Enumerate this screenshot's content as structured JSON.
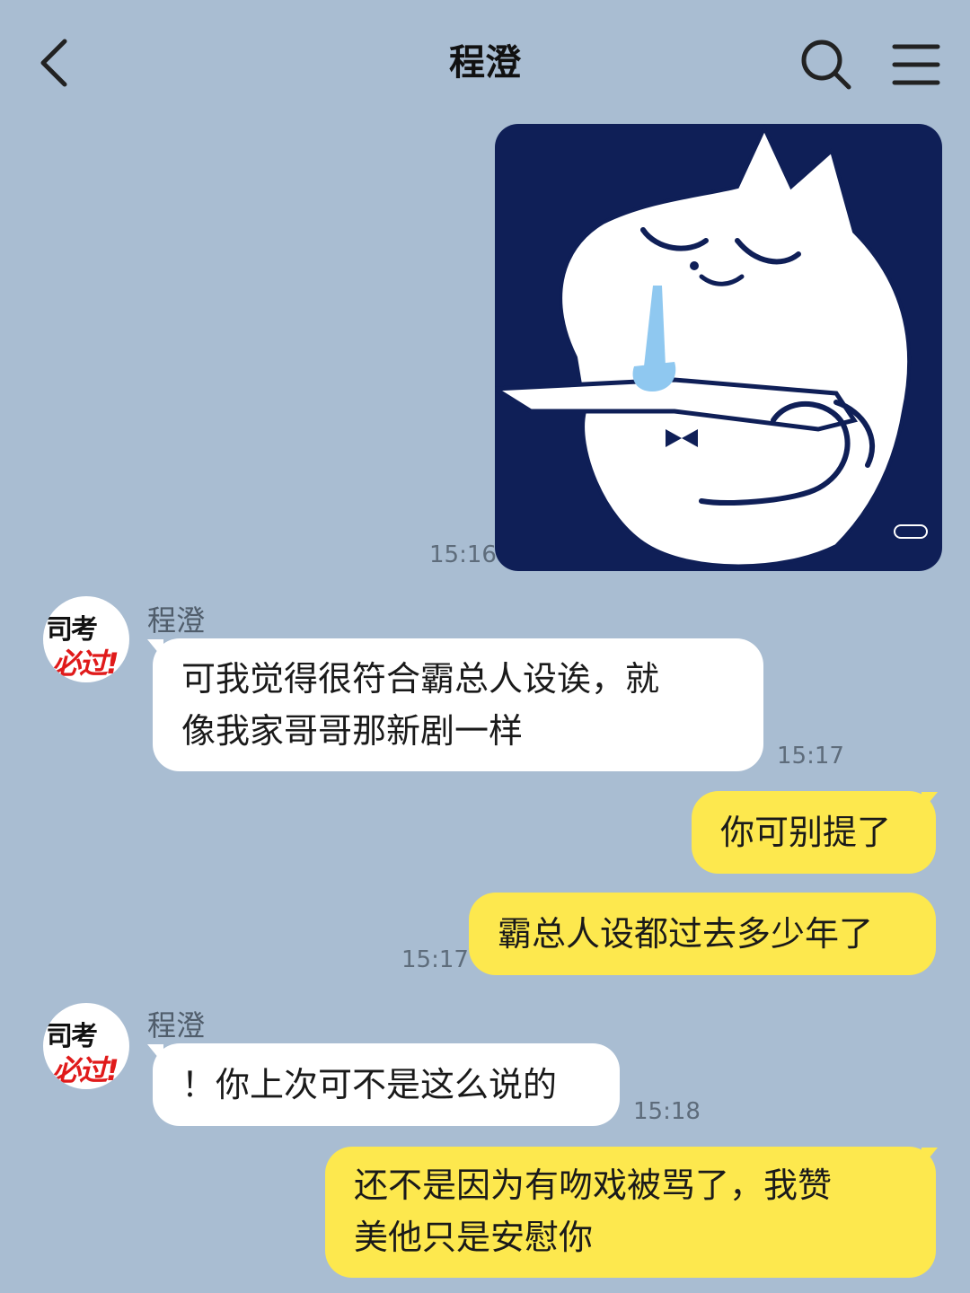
{
  "header": {
    "title": "程澄",
    "back_icon": "chevron-left-icon",
    "search_icon": "search-icon",
    "menu_icon": "hamburger-menu-icon"
  },
  "colors": {
    "background": "#a9bdd2",
    "incoming_bubble": "#ffffff",
    "outgoing_bubble": "#fde84e",
    "sticker_background": "#0f1f57"
  },
  "messages": [
    {
      "direction": "out",
      "type": "sticker",
      "time": "15:16",
      "sticker_description": "white cat crying"
    },
    {
      "direction": "in",
      "sender": "程澄",
      "avatar_text_top": "司考",
      "avatar_text_bottom": "必过!",
      "lines": [
        "可我觉得很符合霸总人设诶，就",
        "像我家哥哥那新剧一样"
      ],
      "time": "15:17"
    },
    {
      "direction": "out",
      "lines": [
        "你可别提了"
      ]
    },
    {
      "direction": "out",
      "lines": [
        "霸总人设都过去多少年了"
      ],
      "time": "15:17"
    },
    {
      "direction": "in",
      "sender": "程澄",
      "avatar_text_top": "司考",
      "avatar_text_bottom": "必过!",
      "lines": [
        "！你上次可不是这么说的"
      ],
      "time": "15:18"
    },
    {
      "direction": "out",
      "lines": [
        "还不是因为有吻戏被骂了，我赞",
        "美他只是安慰你"
      ]
    }
  ]
}
